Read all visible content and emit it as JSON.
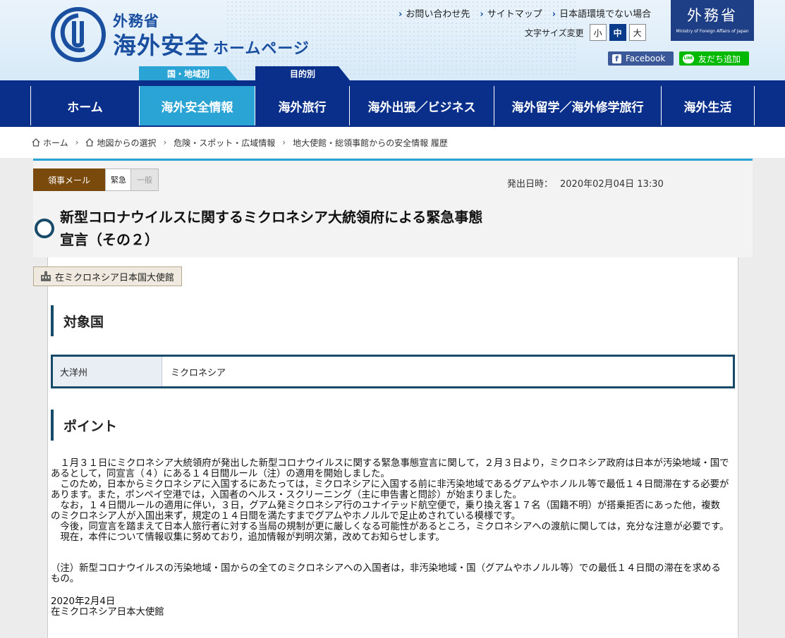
{
  "header": {
    "logo_sub": "外務省",
    "logo_main": "海外安全",
    "logo_main_small": "ホームページ",
    "toplinks": [
      "お問い合わせ先",
      "サイトマップ",
      "日本語環境でない場合"
    ],
    "fontsize_label": "文字サイズ変更",
    "fontsize_options": [
      "小",
      "中",
      "大"
    ],
    "fontsize_selected": "中",
    "mofa_kanji": "外務省",
    "mofa_en": "Ministry of Foreign Affairs of Japan",
    "facebook_label": "Facebook",
    "line_label": "友だち追加",
    "line_icon_text": "LINE",
    "tab_country": "国・地域別",
    "tab_purpose": "目的別"
  },
  "nav": {
    "items": [
      "ホーム",
      "海外安全情報",
      "海外旅行",
      "海外出張／ビジネス",
      "海外留学／海外修学旅行",
      "海外生活"
    ],
    "active": "海外安全情報"
  },
  "breadcrumb": [
    "ホーム",
    "地図からの選択",
    "危険・スポット・広域情報",
    "地大使館・総領事館からの安全情報 履歴"
  ],
  "article": {
    "badge_mail": "領事メール",
    "badge_urgent": "緊急",
    "badge_general": "一般",
    "issued_label": "発出日時：",
    "issued_value": "2020年02月04日 13:30",
    "title_line1": "新型コロナウイルスに関するミクロネシア大統領府による緊急事態",
    "title_line2": "宣言（その２）",
    "embassy": "在ミクロネシア日本国大使館",
    "section_target": "対象国",
    "region_name": "大洋州",
    "region_country": "ミクロネシア",
    "section_points": "ポイント",
    "paragraphs": [
      "１月３１日にミクロネシア大統領府が発出した新型コロナウイルスに関する緊急事態宣言に関して，２月３日より，ミクロネシア政府は日本が汚染地域・国であるとして，同宣言（４）にある１４日間ルール（注）の適用を開始しました。",
      "このため，日本からミクロネシアに入国するにあたっては，ミクロネシアに入国する前に非汚染地域であるグアムやホノルル等で最低１４日間滞在する必要があります。また，ポンペイ空港では，入国者のヘルス・スクリーニング（主に申告書と問診）が始まりました。",
      "なお，１４日間ルールの適用に伴い，３日，グアム発ミクロネシア行のユナイテッド航空便で，乗り換え客１７名（国籍不明）が搭乗拒否にあった他，複数のミクロネシア人が入国出来ず，規定の１４日間を満たすまでグアムやホノルルで足止めされている模様です。",
      "今後，同宣言を踏まえて日本人旅行者に対する当局の規制が更に厳しくなる可能性があるところ，ミクロネシアへの渡航に関しては，充分な注意が必要です。",
      "現在，本件について情報収集に努めており，追加情報が判明次第，改めてお知らせします。"
    ],
    "note": "（注）新型コロナウイルスの汚染地域・国からの全てのミクロネシアへの入国者は，非汚染地域・国（グアムやホノルル等）での最低１４日間の滞在を求めるもの。",
    "sign_date": "2020年2月4日",
    "sign_org": "在ミクロネシア日本大使館"
  },
  "colors": {
    "nav_blue": "#0a2f8a",
    "accent_cyan": "#2aa3d5",
    "mail_brown": "#7a4a0d",
    "section_navy": "#184a6a"
  }
}
